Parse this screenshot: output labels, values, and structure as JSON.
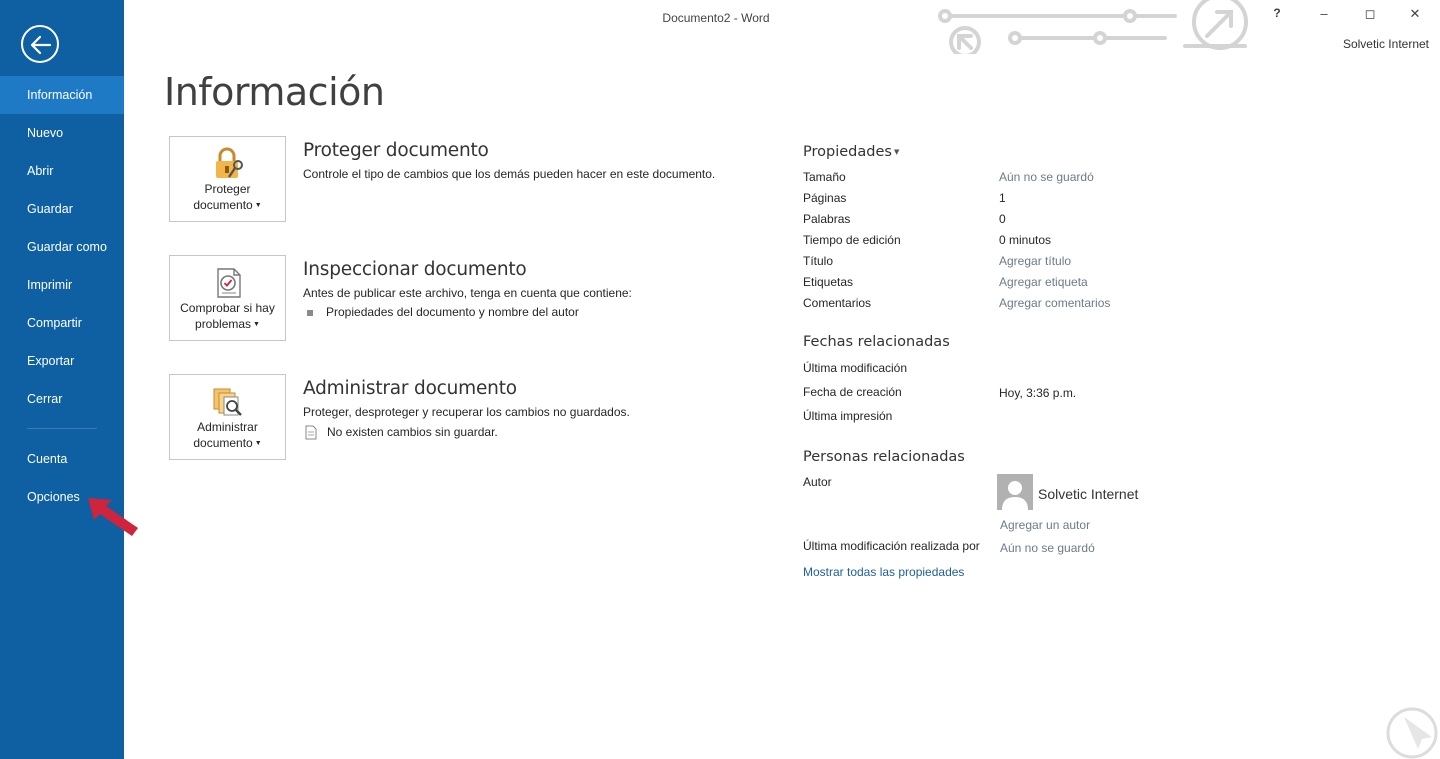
{
  "window": {
    "title": "Documento2 - Word",
    "help": "?",
    "minimize": "–",
    "maximize": "◻",
    "close": "✕",
    "account": "Solvetic Internet"
  },
  "sidebar": {
    "items": [
      {
        "label": "Información"
      },
      {
        "label": "Nuevo"
      },
      {
        "label": "Abrir"
      },
      {
        "label": "Guardar"
      },
      {
        "label": "Guardar como"
      },
      {
        "label": "Imprimir"
      },
      {
        "label": "Compartir"
      },
      {
        "label": "Exportar"
      },
      {
        "label": "Cerrar"
      },
      {
        "label": "Cuenta"
      },
      {
        "label": "Opciones"
      }
    ]
  },
  "main": {
    "title": "Información",
    "sections": [
      {
        "button_line1": "Proteger",
        "button_line2": "documento",
        "title": "Proteger documento",
        "desc": "Controle el tipo de cambios que los demás pueden hacer en este documento."
      },
      {
        "button_line1": "Comprobar si hay",
        "button_line2": "problemas",
        "title": "Inspeccionar documento",
        "desc": "Antes de publicar este archivo, tenga en cuenta que contiene:",
        "bullet": "Propiedades del documento y nombre del autor"
      },
      {
        "button_line1": "Administrar",
        "button_line2": "documento",
        "title": "Administrar documento",
        "desc": "Proteger, desproteger y recuperar los cambios no guardados.",
        "bullet": "No existen cambios sin guardar."
      }
    ]
  },
  "properties": {
    "heading": "Propiedades",
    "rows": [
      {
        "label": "Tamaño",
        "value": "Aún no se guardó"
      },
      {
        "label": "Páginas",
        "value": "1"
      },
      {
        "label": "Palabras",
        "value": "0"
      },
      {
        "label": "Tiempo de edición",
        "value": "0 minutos"
      },
      {
        "label": "Título",
        "value": "Agregar título"
      },
      {
        "label": "Etiquetas",
        "value": "Agregar etiqueta"
      },
      {
        "label": "Comentarios",
        "value": "Agregar comentarios"
      }
    ],
    "dates_heading": "Fechas relacionadas",
    "dates": [
      {
        "label": "Última modificación",
        "value": ""
      },
      {
        "label": "Fecha de creación",
        "value": "Hoy, 3:36 p.m."
      },
      {
        "label": "Última impresión",
        "value": ""
      }
    ],
    "people_heading": "Personas relacionadas",
    "author_label": "Autor",
    "author_name": "Solvetic Internet",
    "add_author": "Agregar un autor",
    "last_modified_by_label": "Última modificación realizada por",
    "last_modified_by_value": "Aún no se guardó",
    "show_all": "Mostrar todas las propiedades"
  },
  "colors": {
    "sidebar": "#0e60a3",
    "sidebar_active": "#1f7ac6",
    "annotation_arrow": "#d0233d",
    "link": "#1e5e9c"
  }
}
